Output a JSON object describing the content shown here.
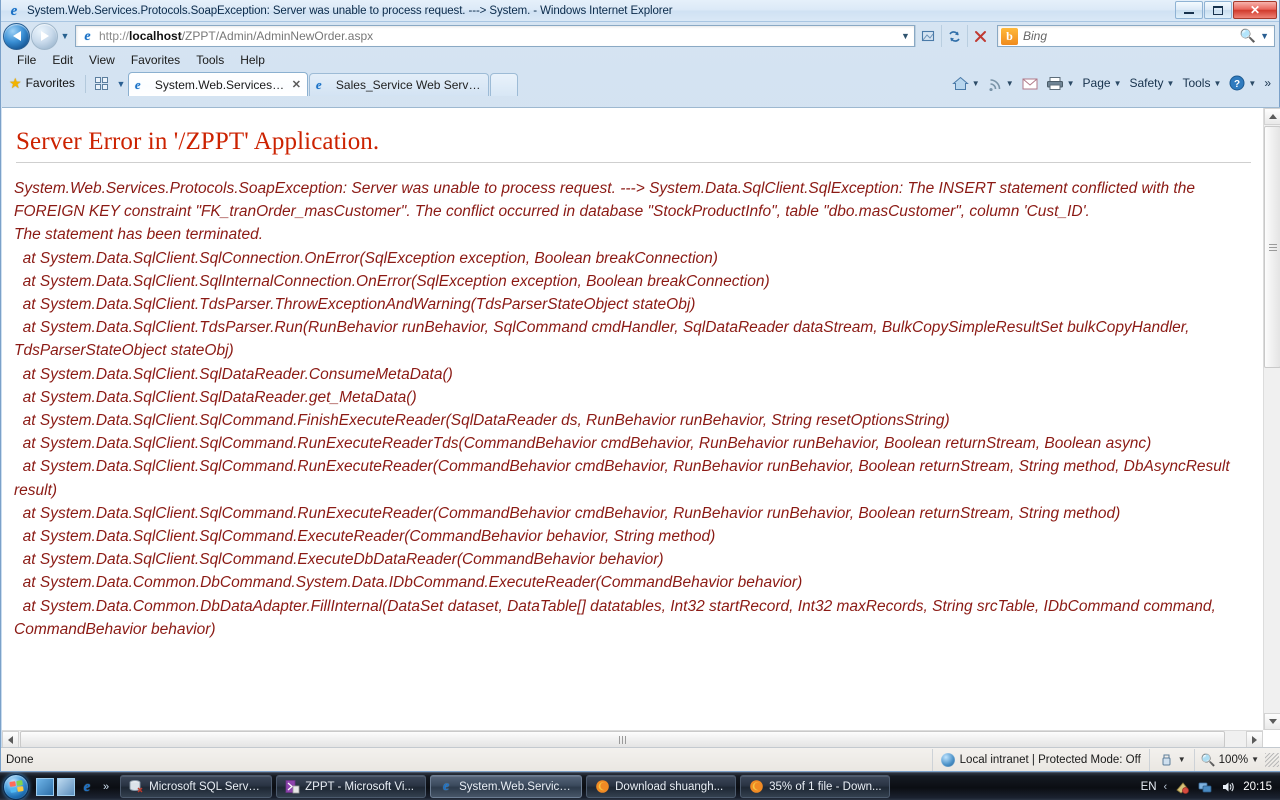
{
  "window": {
    "title": "System.Web.Services.Protocols.SoapException: Server was unable to process request. ---> System. - Windows Internet Explorer",
    "minimize_label": "Minimize",
    "maximize_label": "Maximize",
    "close_label": "✕"
  },
  "address_bar": {
    "scheme": "http://",
    "host": "localhost",
    "path": "/ZPPT/Admin/AdminNewOrder.aspx",
    "full_url": "http://localhost/ZPPT/Admin/AdminNewOrder.aspx"
  },
  "search_bar": {
    "provider": "Bing",
    "provider_initial": "b",
    "value": ""
  },
  "menubar": {
    "items": [
      "File",
      "Edit",
      "View",
      "Favorites",
      "Tools",
      "Help"
    ]
  },
  "favorites": {
    "label": "Favorites"
  },
  "tabs": [
    {
      "label": "System.Web.Services.Pr...",
      "active": true,
      "close": "✕"
    },
    {
      "label": "Sales_Service Web Service",
      "active": false,
      "close": ""
    }
  ],
  "command_bar": {
    "items": [
      "Page",
      "Safety",
      "Tools"
    ],
    "overflow": "»"
  },
  "page": {
    "heading": "Server Error in '/ZPPT' Application.",
    "body": "System.Web.Services.Protocols.SoapException: Server was unable to process request. ---> System.Data.SqlClient.SqlException: The INSERT statement conflicted with the FOREIGN KEY constraint \"FK_tranOrder_masCustomer\". The conflict occurred in database \"StockProductInfo\", table \"dbo.masCustomer\", column 'Cust_ID'.\nThe statement has been terminated.\n  at System.Data.SqlClient.SqlConnection.OnError(SqlException exception, Boolean breakConnection)\n  at System.Data.SqlClient.SqlInternalConnection.OnError(SqlException exception, Boolean breakConnection)\n  at System.Data.SqlClient.TdsParser.ThrowExceptionAndWarning(TdsParserStateObject stateObj)\n  at System.Data.SqlClient.TdsParser.Run(RunBehavior runBehavior, SqlCommand cmdHandler, SqlDataReader dataStream, BulkCopySimpleResultSet bulkCopyHandler, TdsParserStateObject stateObj)\n  at System.Data.SqlClient.SqlDataReader.ConsumeMetaData()\n  at System.Data.SqlClient.SqlDataReader.get_MetaData()\n  at System.Data.SqlClient.SqlCommand.FinishExecuteReader(SqlDataReader ds, RunBehavior runBehavior, String resetOptionsString)\n  at System.Data.SqlClient.SqlCommand.RunExecuteReaderTds(CommandBehavior cmdBehavior, RunBehavior runBehavior, Boolean returnStream, Boolean async)\n  at System.Data.SqlClient.SqlCommand.RunExecuteReader(CommandBehavior cmdBehavior, RunBehavior runBehavior, Boolean returnStream, String method, DbAsyncResult result)\n  at System.Data.SqlClient.SqlCommand.RunExecuteReader(CommandBehavior cmdBehavior, RunBehavior runBehavior, Boolean returnStream, String method)\n  at System.Data.SqlClient.SqlCommand.ExecuteReader(CommandBehavior behavior, String method)\n  at System.Data.SqlClient.SqlCommand.ExecuteDbDataReader(CommandBehavior behavior)\n  at System.Data.Common.DbCommand.System.Data.IDbCommand.ExecuteReader(CommandBehavior behavior)\n  at System.Data.Common.DbDataAdapter.FillInternal(DataSet dataset, DataTable[] datatables, Int32 startRecord, Int32 maxRecords, String srcTable, IDbCommand command, CommandBehavior behavior)"
  },
  "status_bar": {
    "status": "Done",
    "zone": "Local intranet | Protected Mode: Off",
    "zoom": "100%"
  },
  "taskbar": {
    "quick_launch_overflow": "»",
    "buttons": [
      {
        "label": "Microsoft SQL Serve...",
        "active": false
      },
      {
        "label": "ZPPT - Microsoft Vi...",
        "active": false
      },
      {
        "label": "System.Web.Service...",
        "active": true
      },
      {
        "label": "Download shuangh...",
        "active": false
      },
      {
        "label": "35% of 1 file - Down...",
        "active": false
      }
    ],
    "language": "EN",
    "tray_chevron": "‹",
    "clock": "20:15"
  },
  "colors": {
    "error_heading": "#cc2200",
    "error_body": "#8b1a14",
    "chrome_blue": "#cfe0f0"
  }
}
